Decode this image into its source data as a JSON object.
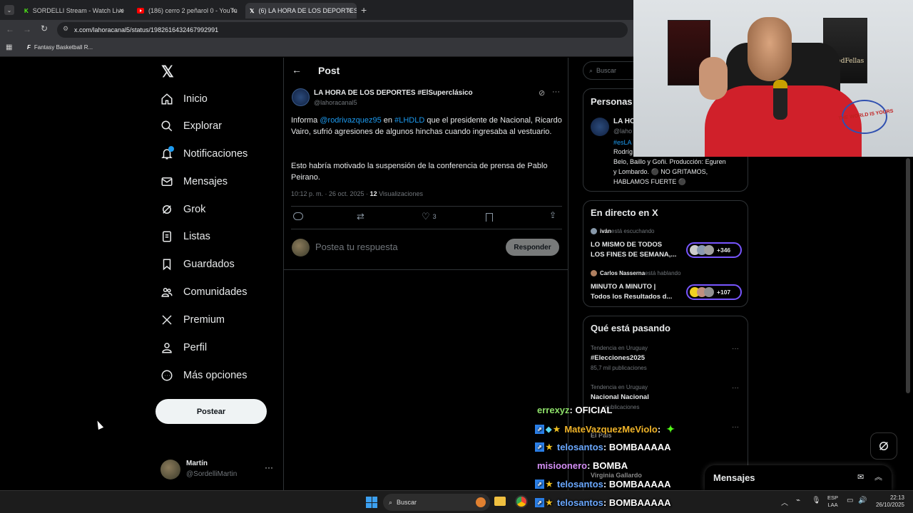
{
  "browser": {
    "tabs": [
      {
        "title": "SORDELLI Stream - Watch Live",
        "icon": "kick-icon",
        "color": "#53fc18"
      },
      {
        "title": "(186) cerro 2 peñarol 0 - YouTu",
        "icon": "youtube-icon",
        "color": "#ff0000"
      },
      {
        "title": "(6) LA HORA DE LOS DEPORTES",
        "icon": "x-icon",
        "color": "#ffffff"
      }
    ],
    "url": "x.com/lahoracanal5/status/1982616432467992991",
    "bookmark": "Fantasy Basketball R..."
  },
  "sidebar": {
    "items": [
      {
        "label": "Inicio",
        "icon": "home-icon"
      },
      {
        "label": "Explorar",
        "icon": "search-icon"
      },
      {
        "label": "Notificaciones",
        "icon": "bell-icon"
      },
      {
        "label": "Mensajes",
        "icon": "envelope-icon"
      },
      {
        "label": "Grok",
        "icon": "grok-icon"
      },
      {
        "label": "Listas",
        "icon": "list-icon"
      },
      {
        "label": "Guardados",
        "icon": "bookmark-icon"
      },
      {
        "label": "Comunidades",
        "icon": "communities-icon"
      },
      {
        "label": "Premium",
        "icon": "x-icon"
      },
      {
        "label": "Perfil",
        "icon": "person-icon"
      },
      {
        "label": "Más opciones",
        "icon": "more-circle-icon"
      }
    ],
    "post_button": "Postear",
    "account": {
      "name": "Martín",
      "handle": "@SordelliMartin"
    }
  },
  "post": {
    "header": "Post",
    "author": "LA HORA DE LOS DEPORTES #ElSuperclásico",
    "handle": "@lahoracanal5",
    "text_1_a": "Informa ",
    "mention": "@rodrivazquez95",
    "text_1_b": " en ",
    "hashtag": "#LHDLD",
    "text_1_c": " que el presidente de Nacional, Ricardo Vairo, sufrió agresiones de algunos hinchas cuando ingresaba al vestuario.",
    "text_2": "Esto habría motivado la suspensión de la conferencia de prensa de Pablo Peirano.",
    "time": "10:12 p. m. · 26 oct. 2025 · ",
    "views_count": "12",
    "views_label": " Visualizaciones",
    "likes": "3",
    "reply_placeholder": "Postea tu respuesta",
    "reply_button": "Responder"
  },
  "right": {
    "search_placeholder": "Buscar",
    "people": {
      "title": "Personas",
      "name": "LA HO",
      "handle": "@laho",
      "hashtag": "#esLA",
      "bio_1": "Rodríg",
      "bio_2": "Belo, Baillo y Goñi. Producción: Eguren",
      "bio_3": "y Lombardo. ⚫ NO GRITAMOS,",
      "bio_4": "HABLAMOS FUERTE ⚫"
    },
    "live": {
      "title": "En directo en X",
      "spaces": [
        {
          "host": "iván",
          "status": " está escuchando",
          "title_1": "LO MISMO DE TODOS",
          "title_2": "LOS FINES DE SEMANA,...",
          "count": "+346"
        },
        {
          "host": "Carlos Nasserna",
          "status": " está hablando",
          "title_1": "MINUTO A MINUTO |",
          "title_2": "Todos los Resultados d...",
          "count": "+107"
        }
      ]
    },
    "trends": {
      "title": "Qué está pasando",
      "items": [
        {
          "context": "Tendencia en Uruguay",
          "name": "#Elecciones2025",
          "posts": "85,7 mil publicaciones"
        },
        {
          "context": "Tendencia en Uruguay",
          "name": "Nacional Nacional",
          "posts": "publicaciones"
        },
        {
          "context": "",
          "name": "El País",
          "posts": ""
        },
        {
          "context": "",
          "name": "Virginia Gallardo",
          "posts": ""
        }
      ]
    },
    "messages_title": "Mensajes"
  },
  "chat": [
    {
      "user": "errexyz",
      "msg": " : OFICIAL",
      "color": "#8ee06a"
    },
    {
      "user": "MateVazquezMeViolo",
      "msg": " :",
      "color": "#f0b429"
    },
    {
      "user": "telosantos",
      "msg": " : BOMBAAAAA",
      "color": "#6aa8ff"
    },
    {
      "user": "misioonero",
      "msg": " : BOMBA",
      "color": "#d48ef5"
    },
    {
      "user": "telosantos",
      "msg": " : BOMBAAAAA",
      "color": "#6aa8ff"
    },
    {
      "user": "telosantos",
      "msg": " : BOMBAAAAA",
      "color": "#6aa8ff"
    }
  ],
  "webcam": {
    "poster_text": "GoodFellas",
    "sign_text": "THE WORLD IS YOURS"
  },
  "taskbar": {
    "search": "Buscar",
    "lang_1": "ESP",
    "lang_2": "LAA",
    "time": "22:13",
    "date": "26/10/2025"
  }
}
